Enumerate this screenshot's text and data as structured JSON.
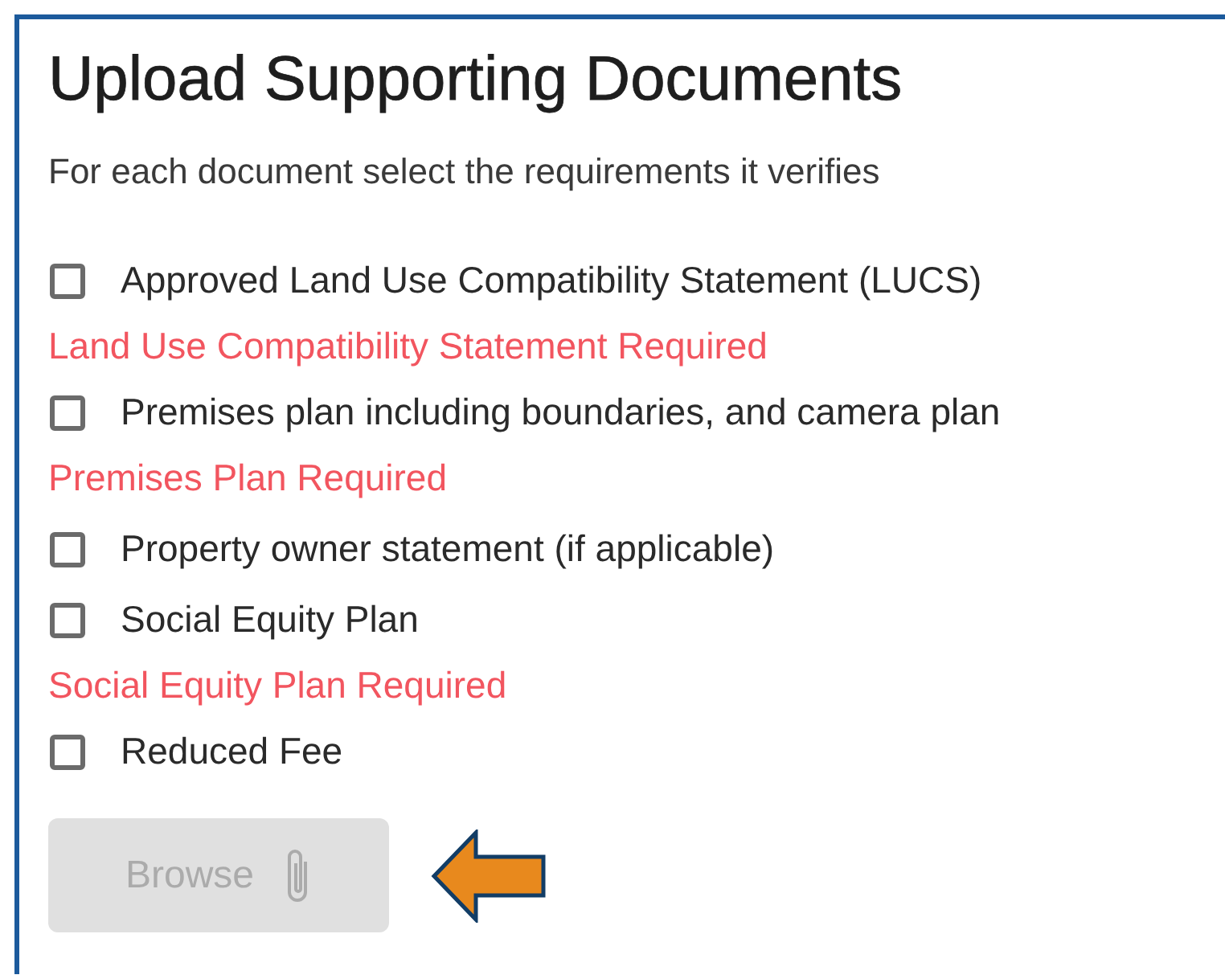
{
  "title": "Upload Supporting Documents",
  "instructions": "For each document select the requirements it verifies",
  "requirements": [
    {
      "label": "Approved Land Use Compatibility Statement (LUCS)",
      "checked": false,
      "error": "Land Use Compatibility Statement Required"
    },
    {
      "label": "Premises plan including boundaries, and camera plan",
      "checked": false,
      "error": "Premises Plan Required"
    },
    {
      "label": "Property owner statement (if applicable)",
      "checked": false
    },
    {
      "label": "Social Equity Plan",
      "checked": false,
      "error": "Social Equity Plan Required"
    },
    {
      "label": "Reduced Fee",
      "checked": false
    }
  ],
  "browse_button": {
    "label": "Browse",
    "disabled": true
  }
}
